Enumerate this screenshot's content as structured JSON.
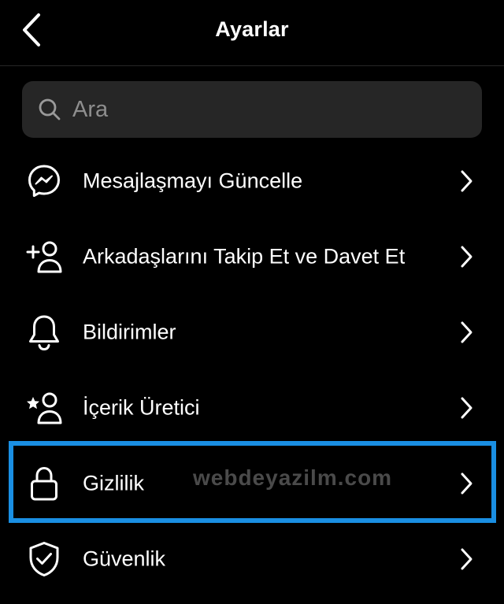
{
  "header": {
    "title": "Ayarlar",
    "back_icon": "chevron-left-icon"
  },
  "search": {
    "placeholder": "Ara",
    "icon": "search-icon"
  },
  "items": [
    {
      "label": "Mesajlaşmayı Güncelle",
      "icon": "messenger-icon"
    },
    {
      "label": "Arkadaşlarını Takip Et ve Davet Et",
      "icon": "add-person-icon"
    },
    {
      "label": "Bildirimler",
      "icon": "bell-icon"
    },
    {
      "label": "İçerik Üretici",
      "icon": "star-person-icon"
    },
    {
      "label": "Gizlilik",
      "icon": "lock-icon",
      "highlighted": true
    },
    {
      "label": "Güvenlik",
      "icon": "shield-check-icon"
    }
  ],
  "watermark": "webdeyazilm.com",
  "colors": {
    "background": "#000000",
    "text": "#ffffff",
    "search_background": "#262626",
    "placeholder": "#8e8e8e",
    "highlight_border": "#1a8fe3",
    "watermark": "#4a4a4a"
  }
}
